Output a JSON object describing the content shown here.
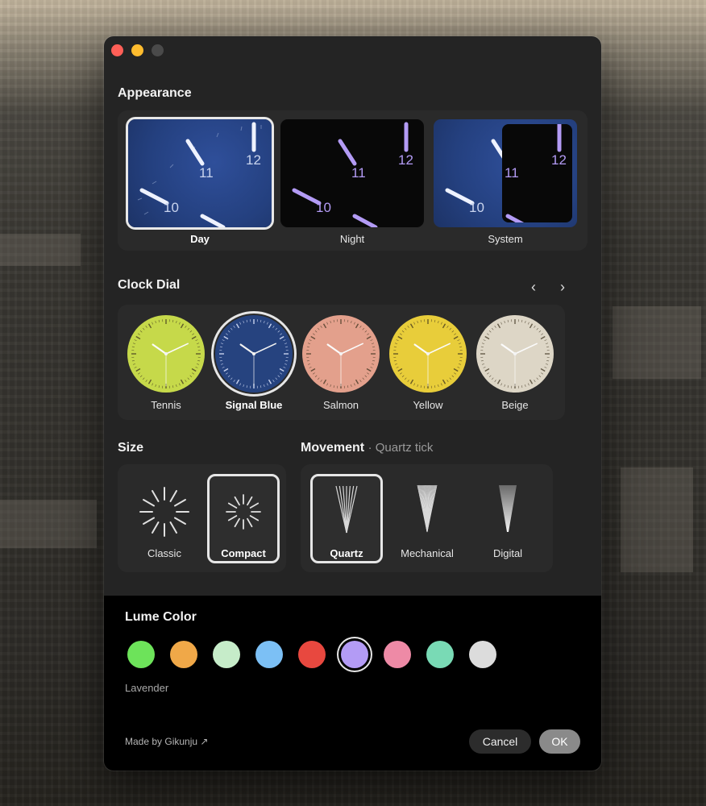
{
  "appearance": {
    "title": "Appearance",
    "options": [
      {
        "label": "Day",
        "selected": true
      },
      {
        "label": "Night",
        "selected": false
      },
      {
        "label": "System",
        "selected": false
      }
    ],
    "numerals": [
      "10",
      "11",
      "12"
    ]
  },
  "clock_dial": {
    "title": "Clock Dial",
    "prev_icon": "chevron-left-icon",
    "next_icon": "chevron-right-icon",
    "dials": [
      {
        "label": "Tennis",
        "color": "#c6d94a",
        "selected": false
      },
      {
        "label": "Signal Blue",
        "color": "#26437f",
        "selected": true
      },
      {
        "label": "Salmon",
        "color": "#e3a08c",
        "selected": false
      },
      {
        "label": "Yellow",
        "color": "#e8cd3a",
        "selected": false
      },
      {
        "label": "Beige",
        "color": "#ddd6c6",
        "selected": false
      }
    ]
  },
  "size": {
    "title": "Size",
    "options": [
      {
        "label": "Classic",
        "selected": false
      },
      {
        "label": "Compact",
        "selected": true
      }
    ]
  },
  "movement": {
    "title": "Movement",
    "subtitle": "· Quartz tick",
    "options": [
      {
        "label": "Quartz",
        "selected": true
      },
      {
        "label": "Mechanical",
        "selected": false
      },
      {
        "label": "Digital",
        "selected": false
      }
    ]
  },
  "lume": {
    "title": "Lume Color",
    "selected_name": "Lavender",
    "swatches": [
      {
        "color": "#6de35a",
        "selected": false
      },
      {
        "color": "#f0a848",
        "selected": false
      },
      {
        "color": "#c6ecc9",
        "selected": false
      },
      {
        "color": "#7cc0f5",
        "selected": false
      },
      {
        "color": "#e8483f",
        "selected": false
      },
      {
        "color": "#b39bf5",
        "selected": true
      },
      {
        "color": "#ee8aa6",
        "selected": false
      },
      {
        "color": "#79dab5",
        "selected": false
      },
      {
        "color": "#dcdcdc",
        "selected": false
      }
    ]
  },
  "footer": {
    "made_by": "Made by Gikunju ↗",
    "cancel_label": "Cancel",
    "ok_label": "OK"
  },
  "colors": {
    "lume_accent": "#b39bf5",
    "window_bg": "#242424",
    "panel_bg": "#2a2a2a"
  }
}
